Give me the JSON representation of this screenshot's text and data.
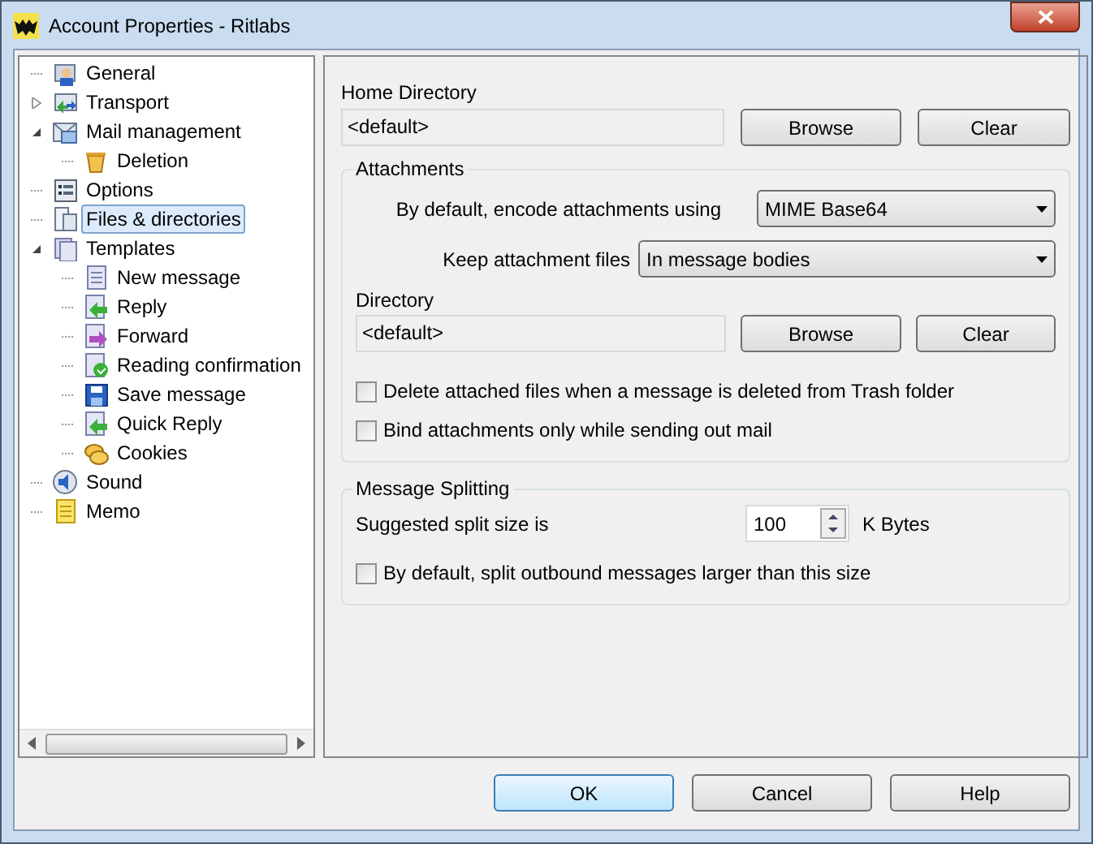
{
  "window": {
    "title": "Account Properties - Ritlabs"
  },
  "tree": [
    {
      "label": "General",
      "kind": "user",
      "selected": false
    },
    {
      "label": "Transport",
      "kind": "transport",
      "selected": false,
      "expanded": false
    },
    {
      "label": "Mail management",
      "kind": "mail",
      "selected": false,
      "expanded": true,
      "children": [
        {
          "label": "Deletion",
          "kind": "bin",
          "selected": false
        }
      ]
    },
    {
      "label": "Options",
      "kind": "options",
      "selected": false
    },
    {
      "label": "Files & directories",
      "kind": "files",
      "selected": true
    },
    {
      "label": "Templates",
      "kind": "templates",
      "selected": false,
      "expanded": true,
      "children": [
        {
          "label": "New message",
          "kind": "page",
          "selected": false
        },
        {
          "label": "Reply",
          "kind": "reply",
          "selected": false
        },
        {
          "label": "Forward",
          "kind": "forward",
          "selected": false
        },
        {
          "label": "Reading confirmation",
          "kind": "confirm",
          "selected": false
        },
        {
          "label": "Save message",
          "kind": "save",
          "selected": false
        },
        {
          "label": "Quick Reply",
          "kind": "reply",
          "selected": false
        },
        {
          "label": "Cookies",
          "kind": "cookies",
          "selected": false
        }
      ]
    },
    {
      "label": "Sound",
      "kind": "sound",
      "selected": false
    },
    {
      "label": "Memo",
      "kind": "memo",
      "selected": false
    }
  ],
  "home_directory": {
    "label": "Home Directory",
    "value": "<default>",
    "buttons": [
      "Browse",
      "Clear"
    ]
  },
  "attachments": {
    "title": "Attachments",
    "encode": {
      "label": "By default, encode attachments using",
      "value": "MIME Base64"
    },
    "keep": {
      "label": "Keep attachment files",
      "value": "In message bodies"
    },
    "directory": {
      "label": "Directory",
      "value": "<default>",
      "buttons": [
        "Browse",
        "Clear"
      ]
    },
    "options": [
      {
        "label": "Delete attached files when a message is deleted from Trash folder",
        "checked": false
      },
      {
        "label": "Bind attachments only while sending out mail",
        "checked": false
      }
    ]
  },
  "splitting": {
    "title": "Message Splitting",
    "size_label": "Suggested split size is",
    "size_value": "100",
    "unit": "K Bytes",
    "options": [
      {
        "label": "By default, split outbound messages larger than this size",
        "checked": false
      }
    ]
  },
  "buttons": [
    {
      "label": "OK",
      "default": true
    },
    {
      "label": "Cancel",
      "default": false
    },
    {
      "label": "Help",
      "default": false
    }
  ]
}
